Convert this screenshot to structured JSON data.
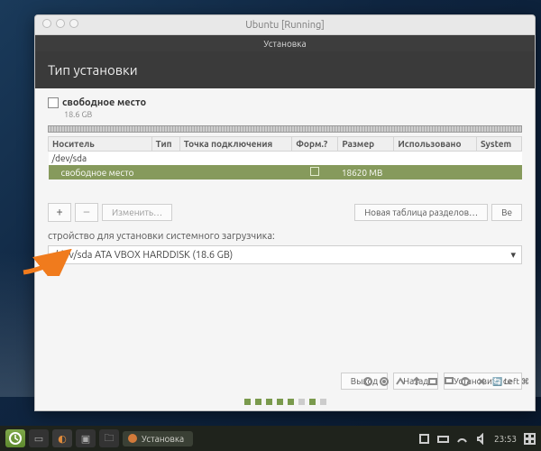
{
  "vm": {
    "title": "Ubuntu [Running]"
  },
  "installer": {
    "windowTitle": "Установка",
    "heading": "Тип установки",
    "freeSpace": {
      "label": "свободное место",
      "size": "18.6 GB"
    },
    "columns": {
      "device": "Носитель",
      "type": "Тип",
      "mount": "Точка подключения",
      "format": "Форм.?",
      "size": "Размер",
      "used": "Использовано",
      "system": "System"
    },
    "rows": {
      "device": "/dev/sda",
      "free": {
        "label": "свободное место",
        "size": "18620 MB"
      }
    },
    "buttons": {
      "plus": "+",
      "minus": "–",
      "change": "Изменить…",
      "newTable": "Новая таблица разделов…",
      "revert": "Ве"
    },
    "loaderLabel": "стройство для установки системного загрузчика:",
    "loaderValue": "/dev/sda ATA VBOX HARDDISK (18.6 GB)",
    "nav": {
      "quit": "Выход",
      "back": "Назад",
      "install": "Установить се"
    }
  },
  "vbox_status": {
    "host": "Left",
    "key": "⌘"
  },
  "taskbar": {
    "appTitle": "Установка",
    "time": "23:53"
  },
  "colors": {
    "accent": "#7a9a4d",
    "row": "#869a5c"
  }
}
